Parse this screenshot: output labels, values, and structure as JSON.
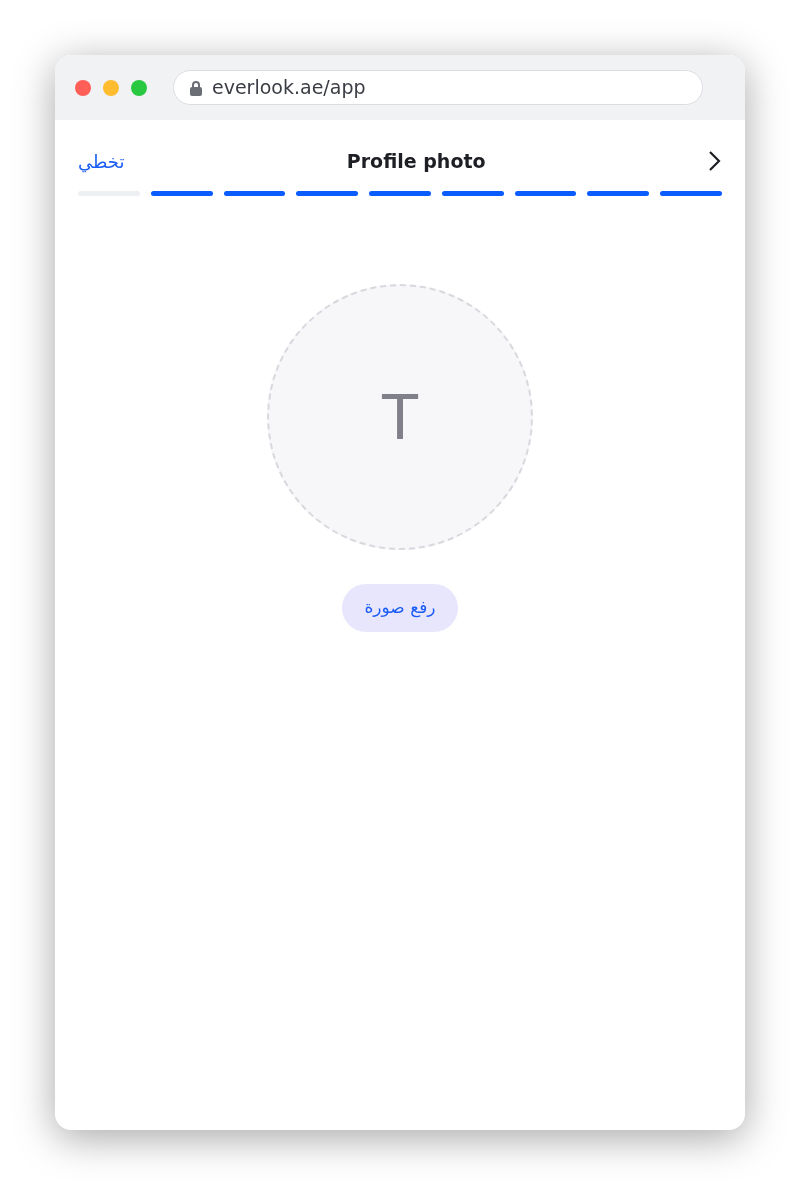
{
  "browser": {
    "url": "everlook.ae/app"
  },
  "header": {
    "skip": "تخطي",
    "title": "Profile photo"
  },
  "progress": [
    {
      "filled": false
    },
    {
      "filled": true
    },
    {
      "filled": true
    },
    {
      "filled": true
    },
    {
      "filled": true
    },
    {
      "filled": true
    },
    {
      "filled": true
    },
    {
      "filled": true
    },
    {
      "filled": true
    }
  ],
  "avatar": {
    "initial": "T"
  },
  "upload_button": "رفع صورة"
}
